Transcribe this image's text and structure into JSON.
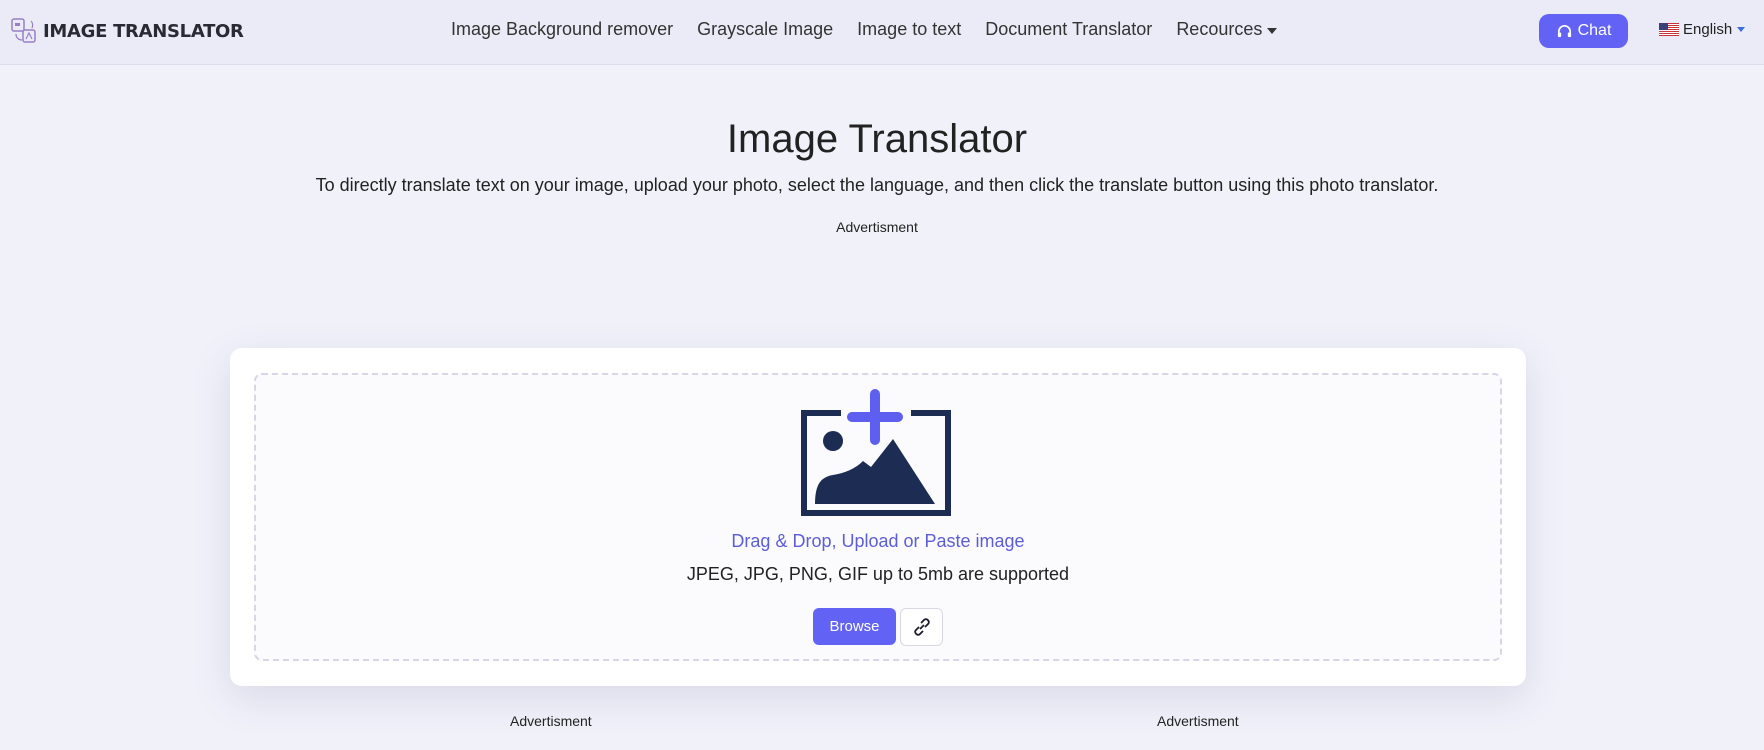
{
  "header": {
    "logo_text": "IMAGE TRANSLATOR",
    "nav": [
      {
        "label": "Image Background remover"
      },
      {
        "label": "Grayscale Image"
      },
      {
        "label": "Image to text"
      },
      {
        "label": "Document Translator"
      },
      {
        "label": "Recources",
        "dropdown": true
      }
    ],
    "chat_label": "Chat",
    "language": "English",
    "accent_color": "#6262f5"
  },
  "hero": {
    "title": "Image Translator",
    "subtitle": "To directly translate text on your image, upload your photo, select the language, and then click the translate button using this photo translator.",
    "ad_label": "Advertisment"
  },
  "upload": {
    "drag_text": "Drag & Drop, Upload or Paste image",
    "support_text": "JPEG, JPG, PNG, GIF up to 5mb are supported",
    "browse_label": "Browse",
    "link_icon": "link-icon"
  },
  "footer_ads": {
    "left": "Advertisment",
    "right": "Advertisment"
  }
}
